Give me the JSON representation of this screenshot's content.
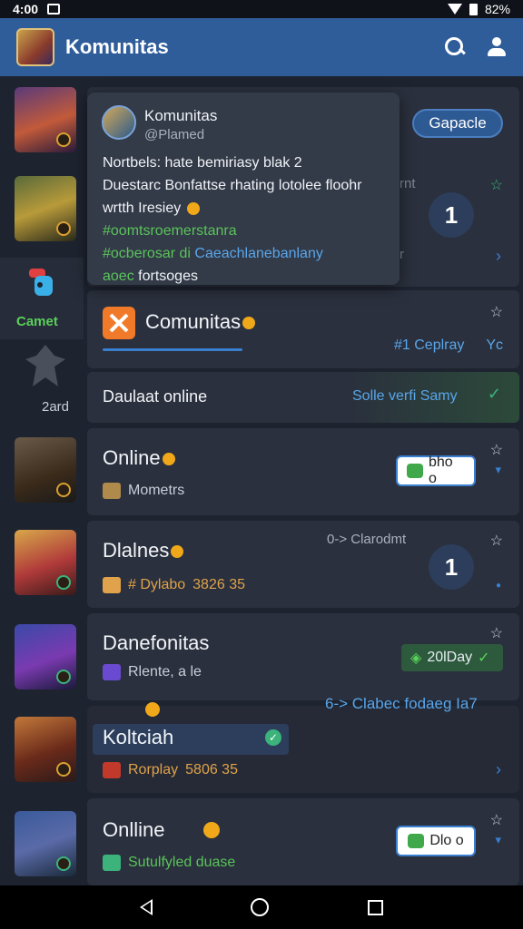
{
  "status_bar": {
    "time": "4:00",
    "battery": "82%"
  },
  "app_bar": {
    "title": "Komunitas",
    "search_icon": "search-icon",
    "profile_icon": "user-icon",
    "accent": "#2f5d9a"
  },
  "popover": {
    "title": "Komunitas",
    "handle": "@Plamed",
    "line1": "Nortbels: hate bemiriasy blak 2",
    "line2": "Duestarc Bonfattse rhating lotolee floohr",
    "line3": "wrtth Iresiey",
    "line4": "#oomtsroemerstanra",
    "line5_tag": "#ocberosar di",
    "line5_link": "Caeachlanebanlany",
    "line6_tag": "aoec",
    "line6_rest": "fortsoges"
  },
  "join_pill": {
    "label": "Gapacle"
  },
  "left": {
    "tab_label": "Camet",
    "label2": "2ard"
  },
  "ghost": {
    "a": "rnt",
    "b": "r"
  },
  "count_badge_1": "1",
  "card_komunitas": {
    "name": "Comunitas",
    "link": "#1 Ceplray",
    "suffix": "Yc"
  },
  "card_status": {
    "label": "Daulaat online",
    "action": "Solle verfi Samy"
  },
  "rows": [
    {
      "name": "Online",
      "sub": "Mometrs",
      "button": "bho o"
    },
    {
      "name": "Dlalnes",
      "sub": "# Dylabo",
      "sub_extra": "3826 35",
      "status": "0-> Clarodmt",
      "count": "1"
    },
    {
      "name": "Danefonitas",
      "sub": "Rlente, a le",
      "button": "20lDay"
    },
    {
      "name": "Koltciah",
      "sub": "Rorplay",
      "sub_extra": "5806 35",
      "link": "6-> Clabec fodaeg Ia7"
    },
    {
      "name": "Onlline",
      "sub": "Sutulfyled duase",
      "button": "Dlo o"
    }
  ]
}
